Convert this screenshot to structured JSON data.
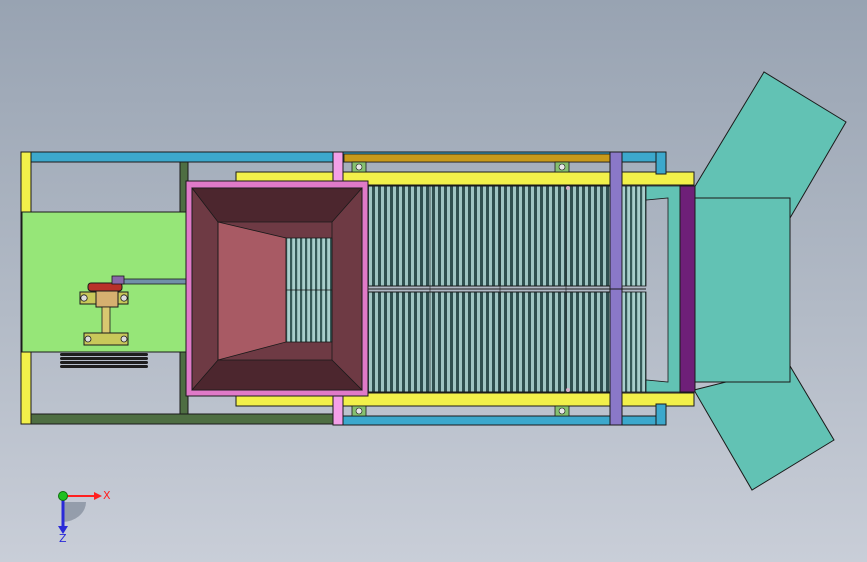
{
  "triad": {
    "x_label": "X",
    "z_label": "Z",
    "x_color": "#ff2020",
    "z_color": "#2a2ad8",
    "y_color": "#20c020"
  },
  "colors": {
    "background_top": "#98a3b2",
    "background_bottom": "#c9ced8",
    "motor_plate": "#96e678",
    "frame_blue": "#3ca8cc",
    "frame_green": "#4e6e42",
    "rail_yellow": "#f2f04a",
    "rail_gold": "#c89a1a",
    "hopper_outline": "#e07ac8",
    "hopper_inner": "#6e3a44",
    "hopper_throat": "#a85a64",
    "screen_dark": "#2f4f4f",
    "screen_light": "#9fc4c2",
    "chute_teal": "#62c2b4",
    "purple_bar": "#6e1f78",
    "pink_post": "#f4a0e8"
  }
}
